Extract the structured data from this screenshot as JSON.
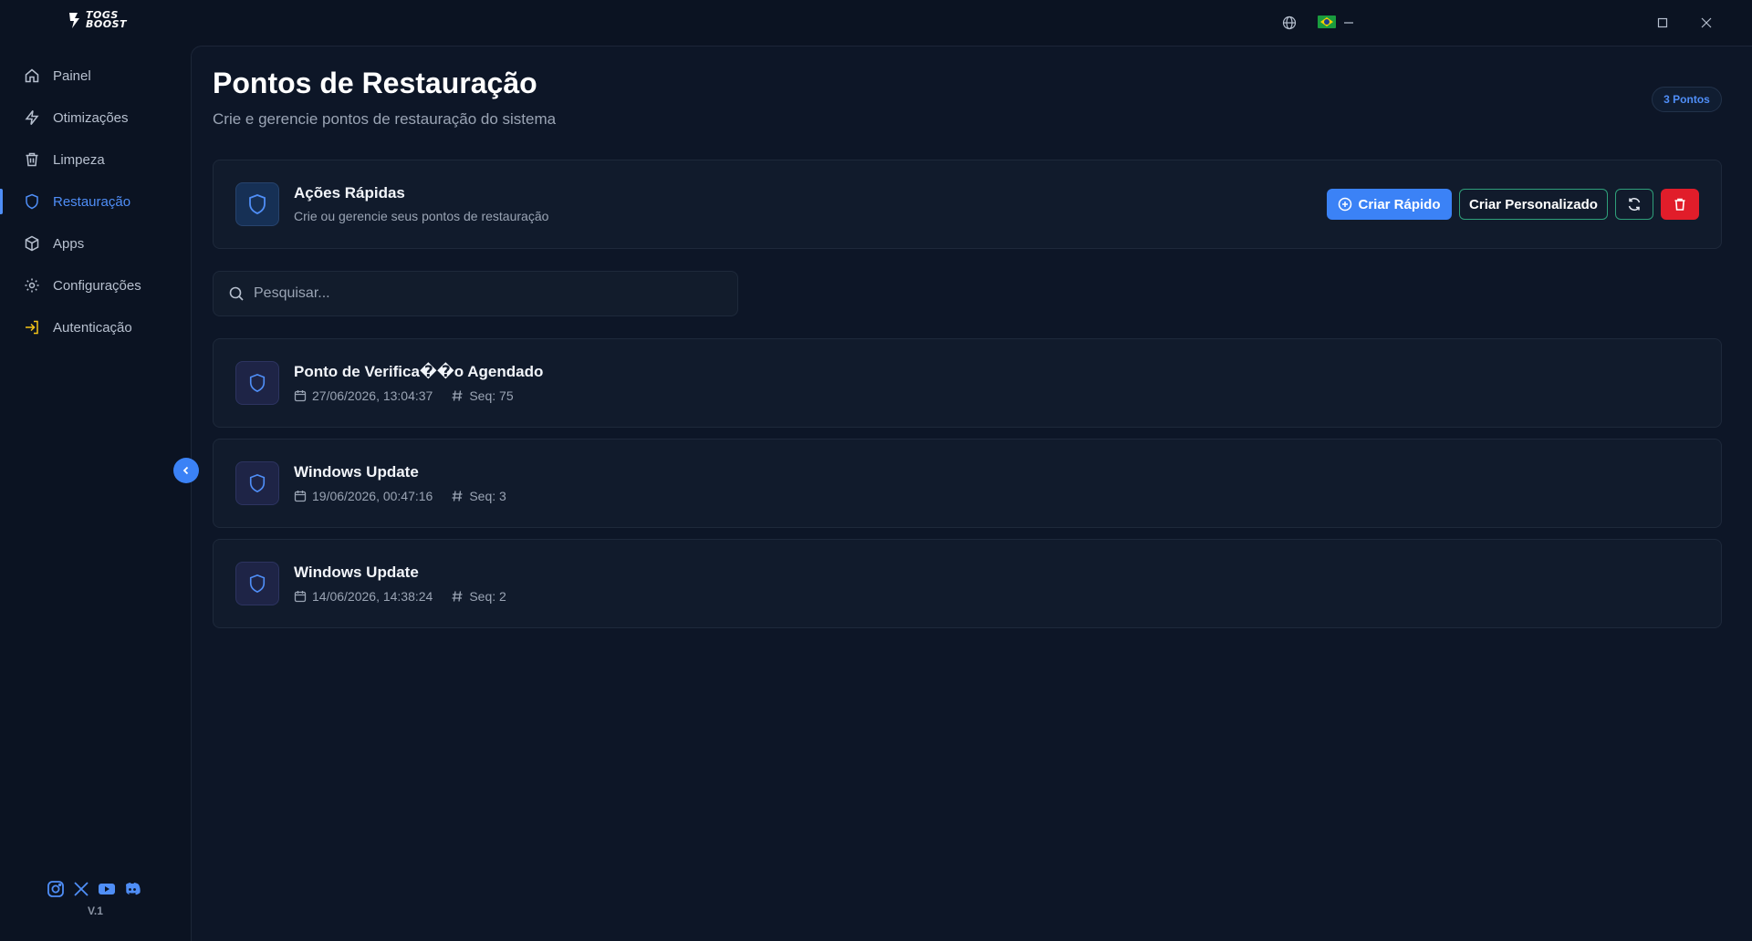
{
  "app": {
    "logo_text": "TOGS\nBOOST",
    "version": "V.1"
  },
  "sidebar": {
    "items": [
      {
        "label": "Painel",
        "icon": "home-icon"
      },
      {
        "label": "Otimizações",
        "icon": "lightning-icon"
      },
      {
        "label": "Limpeza",
        "icon": "trash-icon"
      },
      {
        "label": "Restauração",
        "icon": "shield-icon",
        "active": true
      },
      {
        "label": "Apps",
        "icon": "package-icon"
      },
      {
        "label": "Configurações",
        "icon": "gear-icon"
      },
      {
        "label": "Autenticação",
        "icon": "login-icon"
      }
    ],
    "social": [
      "instagram-icon",
      "x-icon",
      "youtube-icon",
      "discord-icon"
    ]
  },
  "header": {
    "title": "Pontos de Restauração",
    "subtitle": "Crie e gerencie pontos de restauração do sistema",
    "badge": "3 Pontos"
  },
  "quick_actions": {
    "title": "Ações Rápidas",
    "subtitle": "Crie ou gerencie seus pontos de restauração",
    "create_quick_label": "Criar Rápido",
    "create_custom_label": "Criar Personalizado"
  },
  "search": {
    "placeholder": "Pesquisar..."
  },
  "restore_points": [
    {
      "title": "Ponto de Verifica��o Agendado",
      "date": "27/06/2026, 13:04:37",
      "seq": "Seq: 75"
    },
    {
      "title": "Windows Update",
      "date": "19/06/2026, 00:47:16",
      "seq": "Seq: 3"
    },
    {
      "title": "Windows Update",
      "date": "14/06/2026, 14:38:24",
      "seq": "Seq: 2"
    }
  ],
  "colors": {
    "accent": "#3b82f6",
    "danger": "#e11d2a",
    "outline": "#2f9f7a",
    "background": "#0b1322"
  }
}
